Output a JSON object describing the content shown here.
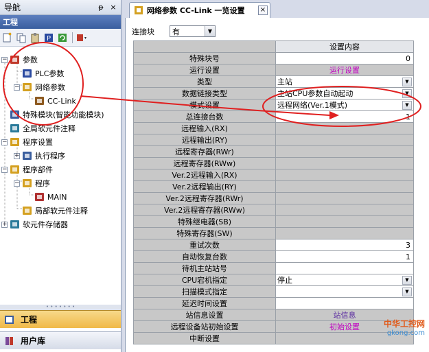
{
  "nav": {
    "title": "导航",
    "pin_label": "ᵽ",
    "close_label": "×",
    "project_header": "工程",
    "tree": [
      {
        "label": "参数",
        "level": 0,
        "expander": "−"
      },
      {
        "label": "PLC参数",
        "level": 1,
        "expander": ""
      },
      {
        "label": "网络参数",
        "level": 1,
        "expander": "−"
      },
      {
        "label": "CC-Link",
        "level": 2,
        "expander": ""
      },
      {
        "label": "特殊模块(智能功能模块)",
        "level": 0,
        "expander": ""
      },
      {
        "label": "全局软元件注释",
        "level": 0,
        "expander": ""
      },
      {
        "label": "程序设置",
        "level": 0,
        "expander": "−"
      },
      {
        "label": "执行程序",
        "level": 1,
        "expander": "+"
      },
      {
        "label": "程序部件",
        "level": 0,
        "expander": "−"
      },
      {
        "label": "程序",
        "level": 1,
        "expander": "−"
      },
      {
        "label": "MAIN",
        "level": 2,
        "expander": ""
      },
      {
        "label": "局部软元件注释",
        "level": 1,
        "expander": ""
      },
      {
        "label": "软元件存储器",
        "level": 0,
        "expander": "+"
      }
    ],
    "bottom_tabs": {
      "active": "工程",
      "inactive": "用户库"
    }
  },
  "tab": {
    "title": "网络参数  CC-Link 一览设置",
    "close_label": "×"
  },
  "connection": {
    "label": "连接块",
    "value": "有"
  },
  "grid": {
    "header": "设置内容",
    "rows": [
      {
        "label": "特殊块号",
        "value": "0",
        "kind": "num"
      },
      {
        "label": "运行设置",
        "value": "运行设置",
        "kind": "button"
      },
      {
        "label": "类型",
        "value": "主站",
        "kind": "combo"
      },
      {
        "label": "数据链接类型",
        "value": "主站CPU参数自动起动",
        "kind": "combo"
      },
      {
        "label": "模式设置",
        "value": "远程网络(Ver.1模式)",
        "kind": "combo"
      },
      {
        "label": "总连接台数",
        "value": "1",
        "kind": "num"
      },
      {
        "label": "远程输入(RX)",
        "value": "",
        "kind": "gray"
      },
      {
        "label": "远程输出(RY)",
        "value": "",
        "kind": "gray"
      },
      {
        "label": "远程寄存器(RWr)",
        "value": "",
        "kind": "gray"
      },
      {
        "label": "远程寄存器(RWw)",
        "value": "",
        "kind": "gray"
      },
      {
        "label": "Ver.2远程输入(RX)",
        "value": "",
        "kind": "gray"
      },
      {
        "label": "Ver.2远程输出(RY)",
        "value": "",
        "kind": "gray"
      },
      {
        "label": "Ver.2远程寄存器(RWr)",
        "value": "",
        "kind": "gray"
      },
      {
        "label": "Ver.2远程寄存器(RWw)",
        "value": "",
        "kind": "gray"
      },
      {
        "label": "特殊继电器(SB)",
        "value": "",
        "kind": "gray"
      },
      {
        "label": "特殊寄存器(SW)",
        "value": "",
        "kind": "gray"
      },
      {
        "label": "重试次数",
        "value": "3",
        "kind": "num"
      },
      {
        "label": "自动恢复台数",
        "value": "1",
        "kind": "num"
      },
      {
        "label": "待机主站站号",
        "value": "",
        "kind": "white"
      },
      {
        "label": "CPU宕机指定",
        "value": "停止",
        "kind": "combo"
      },
      {
        "label": "扫描模式指定",
        "value": "",
        "kind": "combo"
      },
      {
        "label": "延迟时间设置",
        "value": "",
        "kind": "white"
      },
      {
        "label": "站信息设置",
        "value": "站信息",
        "kind": "button"
      },
      {
        "label": "远程设备站初始设置",
        "value": "初始设置",
        "kind": "button"
      },
      {
        "label": "中断设置",
        "value": "",
        "kind": "gray"
      }
    ]
  },
  "watermark": {
    "text": "中华工控网",
    "sub": "gkong.com"
  },
  "colors": {
    "annotation": "#e02020",
    "button_text": "#c000c0",
    "accent": "#f0b948"
  }
}
